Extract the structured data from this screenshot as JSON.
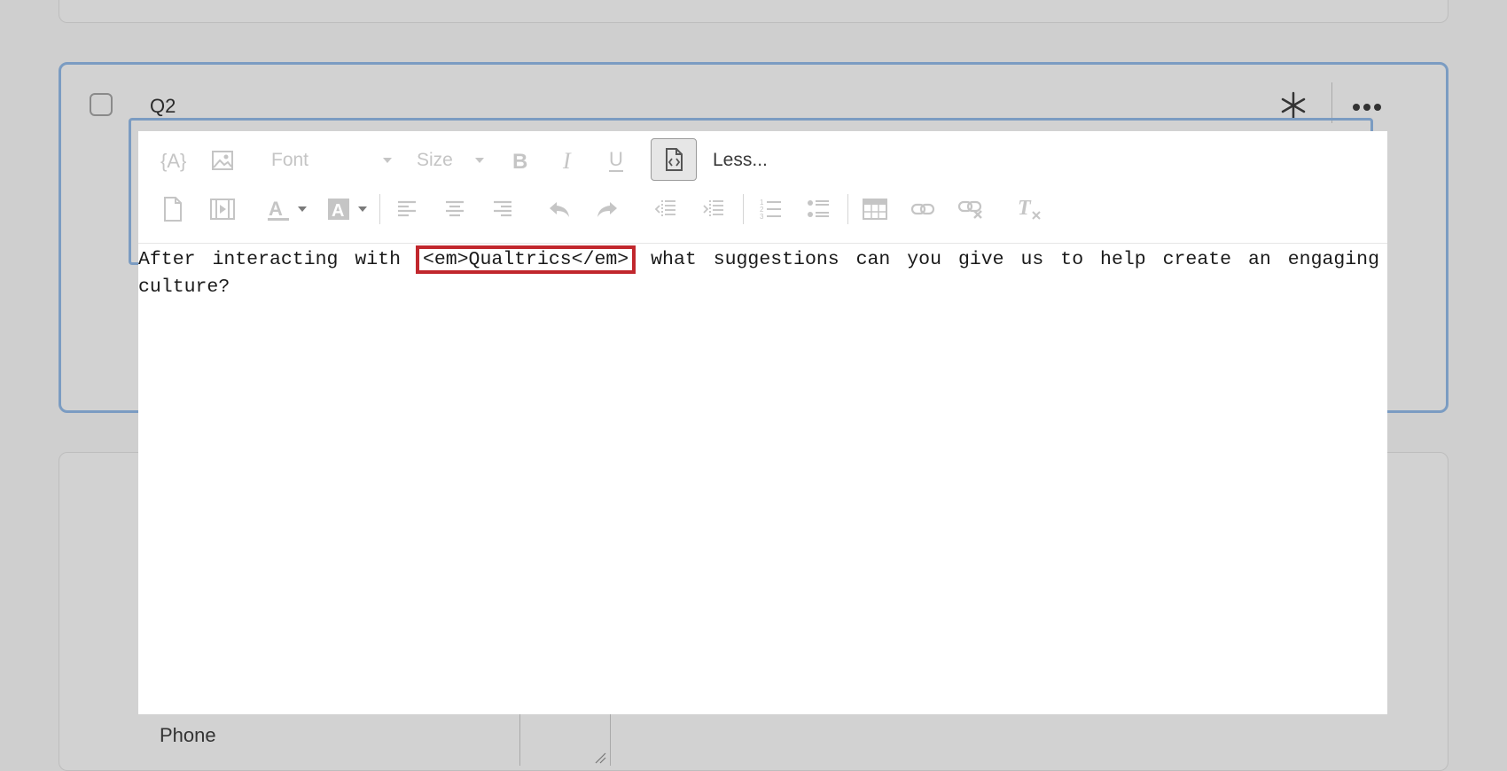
{
  "question": {
    "label": "Q2"
  },
  "toolbar": {
    "font_label": "Font",
    "size_label": "Size",
    "less_label": "Less..."
  },
  "editor": {
    "text_before": "After interacting with ",
    "highlighted_html": "<em>Qualtrics</em>",
    "text_after": " what suggestions can you give us to help create an engaging culture?"
  },
  "bottom": {
    "phone_label": "Phone"
  },
  "colors": {
    "selection_border": "#7b9cc2",
    "highlight_box": "#c1272d",
    "disabled_icon": "#c5c5c5"
  }
}
